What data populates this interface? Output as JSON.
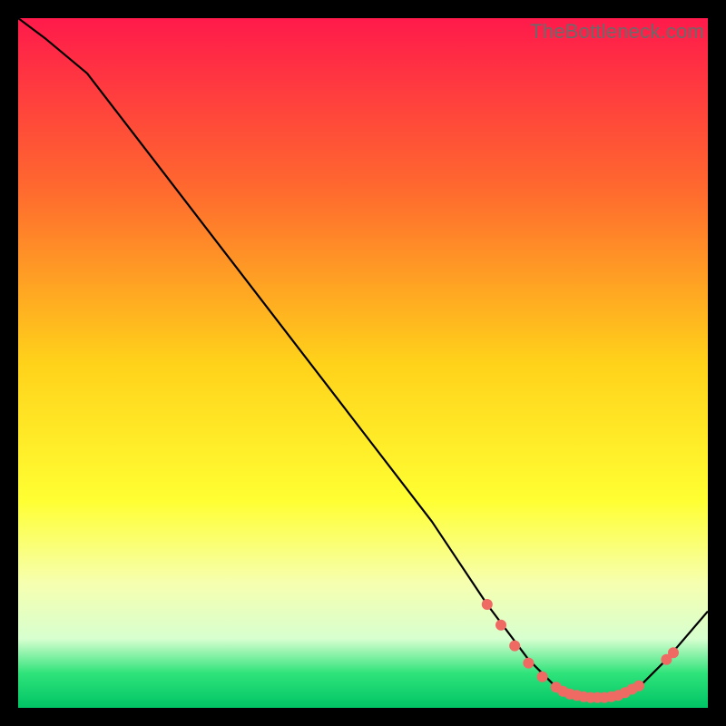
{
  "watermark": "TheBottleneck.com",
  "chart_data": {
    "type": "line",
    "title": "",
    "xlabel": "",
    "ylabel": "",
    "xlim": [
      0,
      100
    ],
    "ylim": [
      0,
      100
    ],
    "grid": false,
    "legend": false,
    "gradient_stops": [
      {
        "offset": 0.0,
        "color": "#ff1a4b"
      },
      {
        "offset": 0.25,
        "color": "#ff6a2e"
      },
      {
        "offset": 0.5,
        "color": "#ffd21a"
      },
      {
        "offset": 0.7,
        "color": "#ffff33"
      },
      {
        "offset": 0.82,
        "color": "#f6ffb0"
      },
      {
        "offset": 0.9,
        "color": "#d7ffcf"
      },
      {
        "offset": 0.95,
        "color": "#2fe37a"
      },
      {
        "offset": 1.0,
        "color": "#00c465"
      }
    ],
    "series": [
      {
        "name": "bottleneck-curve",
        "x": [
          0,
          4,
          10,
          20,
          30,
          40,
          50,
          60,
          68,
          74,
          78,
          82,
          86,
          90,
          94,
          100
        ],
        "y": [
          100,
          97,
          92,
          79,
          66,
          53,
          40,
          27,
          15,
          7,
          3,
          1.5,
          1.5,
          3,
          7,
          14
        ]
      }
    ],
    "markers": {
      "name": "highlight-dots",
      "color": "#ef6a63",
      "radius": 6,
      "points": [
        {
          "x": 68,
          "y": 15
        },
        {
          "x": 70,
          "y": 12
        },
        {
          "x": 72,
          "y": 9
        },
        {
          "x": 74,
          "y": 6.5
        },
        {
          "x": 76,
          "y": 4.5
        },
        {
          "x": 78,
          "y": 3
        },
        {
          "x": 79,
          "y": 2.4
        },
        {
          "x": 80,
          "y": 2
        },
        {
          "x": 81,
          "y": 1.8
        },
        {
          "x": 82,
          "y": 1.6
        },
        {
          "x": 83,
          "y": 1.5
        },
        {
          "x": 84,
          "y": 1.5
        },
        {
          "x": 85,
          "y": 1.5
        },
        {
          "x": 86,
          "y": 1.6
        },
        {
          "x": 87,
          "y": 1.8
        },
        {
          "x": 88,
          "y": 2.2
        },
        {
          "x": 89,
          "y": 2.7
        },
        {
          "x": 90,
          "y": 3.2
        },
        {
          "x": 94,
          "y": 7
        },
        {
          "x": 95,
          "y": 8
        }
      ]
    }
  }
}
